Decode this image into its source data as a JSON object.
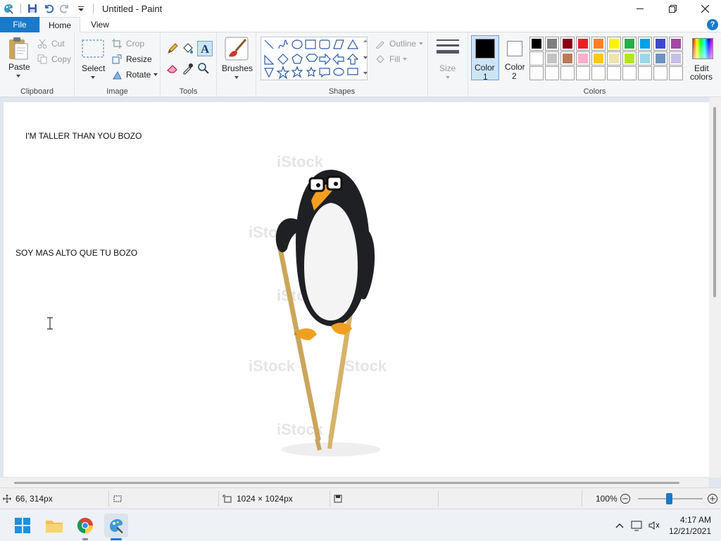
{
  "window": {
    "title": "Untitled - Paint"
  },
  "tabs": {
    "file": "File",
    "home": "Home",
    "view": "View"
  },
  "clipboard": {
    "paste": "Paste",
    "cut": "Cut",
    "copy": "Copy",
    "label": "Clipboard"
  },
  "image": {
    "select": "Select",
    "crop": "Crop",
    "resize": "Resize",
    "rotate": "Rotate",
    "label": "Image"
  },
  "tools": {
    "label": "Tools"
  },
  "brushes": {
    "label": "Brushes"
  },
  "shapes": {
    "outline": "Outline",
    "fill": "Fill",
    "label": "Shapes"
  },
  "size": {
    "label": "Size"
  },
  "colors": {
    "color1_label": "Color",
    "color1_num": "1",
    "color2_label": "Color",
    "color2_num": "2",
    "edit1": "Edit",
    "edit2": "colors",
    "label": "Colors",
    "color1": "#000000",
    "color2": "#ffffff",
    "palette": [
      "#000000",
      "#7f7f7f",
      "#880015",
      "#ed1c24",
      "#ff7f27",
      "#fff200",
      "#22b14c",
      "#00a2e8",
      "#3f48cc",
      "#a349a4",
      "#ffffff",
      "#c3c3c3",
      "#b97a57",
      "#ffaec9",
      "#ffc90e",
      "#efe4b0",
      "#b5e61d",
      "#99d9ea",
      "#7092be",
      "#c8bfe7",
      "",
      "",
      "",
      "",
      "",
      "",
      "",
      "",
      "",
      ""
    ]
  },
  "canvas": {
    "text1": "I'M TALLER THAN YOU BOZO",
    "text2": "SOY MAS ALTO QUE TU BOZO",
    "watermark": "iStock"
  },
  "status": {
    "cursor_pos": "66, 314px",
    "image_size": "1024 × 1024px",
    "zoom": "100%"
  },
  "taskbar": {
    "time": "4:17 AM",
    "date": "12/21/2021"
  }
}
